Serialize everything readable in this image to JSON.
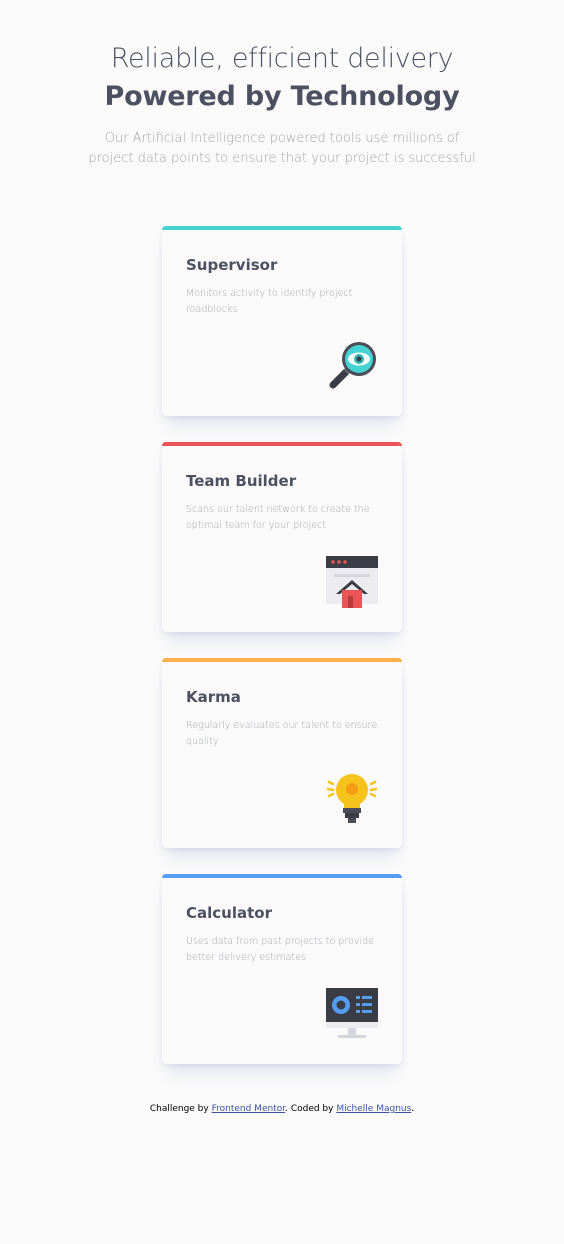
{
  "header": {
    "title_light": "Reliable, efficient delivery",
    "title_bold": "Powered by Technology",
    "subtitle": "Our Artificial Intelligence powered tools use millions of project data points to ensure that your project is successful"
  },
  "cards": [
    {
      "title": "Supervisor",
      "description": "Monitors activity to identify project roadblocks",
      "accent": "#44d3d2",
      "icon": "magnifier-eye-icon"
    },
    {
      "title": "Team Builder",
      "description": "Scans our talent network to create the optimal team for your project",
      "accent": "#ea5454",
      "icon": "browser-house-icon"
    },
    {
      "title": "Karma",
      "description": "Regularly evaluates our talent to ensure quality",
      "accent": "#fcaf4a",
      "icon": "lightbulb-icon"
    },
    {
      "title": "Calculator",
      "description": "Uses data from past projects to provide better delivery estimates",
      "accent": "#549ef2",
      "icon": "monitor-dashboard-icon"
    }
  ],
  "footer": {
    "prefix": "Challenge by ",
    "challenge_link": "Frontend Mentor",
    "middle": ". Coded by ",
    "author_link": "Michelle Magnus",
    "suffix": "."
  }
}
